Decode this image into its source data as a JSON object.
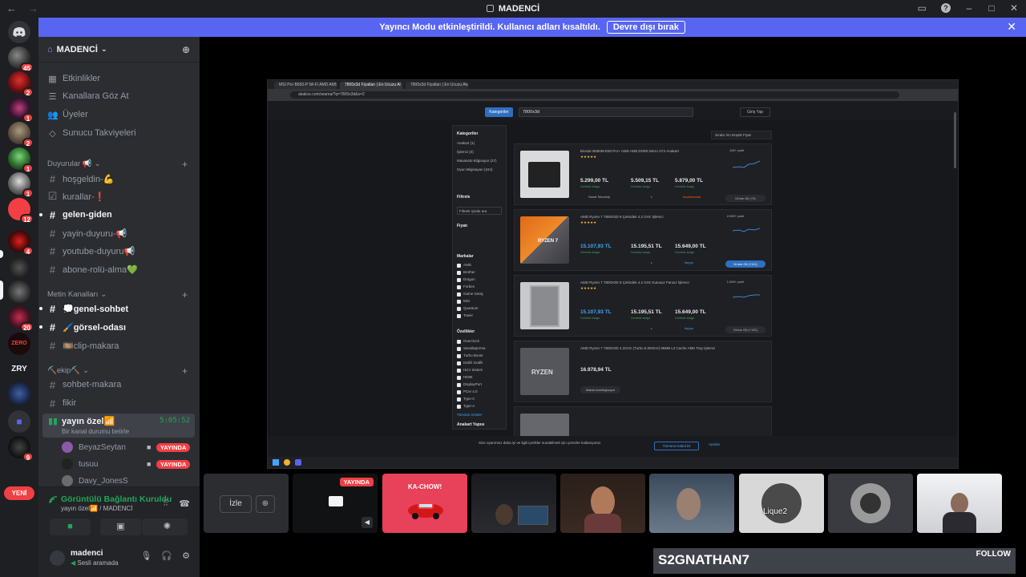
{
  "window": {
    "title": "MADENCİ"
  },
  "banner": {
    "text": "Yayıncı Modu etkinleştirildi. Kullanıcı adları kısaltıldı.",
    "button": "Devre dışı bırak"
  },
  "guilds": {
    "badges": [
      "45",
      "2",
      "1",
      "2",
      "1",
      "1",
      "12",
      "4",
      "20",
      "9"
    ],
    "zry": "ZRY",
    "new_label": "YENİ"
  },
  "server": {
    "name": "MADENCİ",
    "nav": [
      {
        "icon": "calendar-icon",
        "label": "Etkinlikler"
      },
      {
        "icon": "browse-icon",
        "label": "Kanallara Göz At"
      },
      {
        "icon": "members-icon",
        "label": "Üyeler"
      },
      {
        "icon": "boost-icon",
        "label": "Sunucu Takviyeleri"
      }
    ],
    "categories": {
      "duyurular": "Duyurular 📢",
      "metin": "Metin Kanalları",
      "ekip": "⛏️ekip⛏️"
    },
    "channels_duyurular": [
      {
        "name": "hoşgeldin-💪",
        "unread": false
      },
      {
        "name": "kurallar-❗",
        "unread": false
      },
      {
        "name": "gelen-giden",
        "unread": true
      },
      {
        "name": "yayin-duyuru-📢",
        "unread": false
      },
      {
        "name": "youtube-duyuru📢",
        "unread": false
      },
      {
        "name": "abone-rolü-alma💚",
        "unread": false
      }
    ],
    "channels_metin": [
      {
        "name": "💭genel-sohbet",
        "unread": true
      },
      {
        "name": "🖌️görsel-odası",
        "unread": true
      },
      {
        "name": "🎞️clip-makara",
        "unread": false
      }
    ],
    "channels_ekip": [
      {
        "name": "sohbet-makara",
        "unread": false
      },
      {
        "name": "fikir",
        "unread": false
      }
    ],
    "voice": {
      "name": "yayın özel📶",
      "time": "5:05:52",
      "status": "Bir kanal durumu belirle",
      "members": [
        {
          "name": "BeyazSeytan",
          "live": "YAYINDA"
        },
        {
          "name": "tusuu",
          "live": "YAYINDA"
        },
        {
          "name": "Davy_JonesS",
          "live": ""
        }
      ]
    }
  },
  "rtc": {
    "state": "Görüntülü Bağlantı Kuruldu",
    "sub": "yayın özel📶 / MADENCİ"
  },
  "user": {
    "name": "madenci",
    "status": "Sesli aramada"
  },
  "stream": {
    "tabs": [
      "MSI Pro B650-P Wi-Fi AMD AM5",
      "7800x3d Fiyatları | En Ucuzu Al",
      "7800x3d Fiyatları | En Ucuzu Akak"
    ],
    "url": "akakce.com/arama/?q=7800x3d&s=2",
    "category_btn": "Kategoriler",
    "search": "7800x3d",
    "login": "Giriş Yap",
    "sort": "Sırala: En Düşük Fiyat",
    "filter_sections": {
      "kategoriler": "Kategoriler",
      "kat_items": [
        "Anakart (1)",
        "İşlemci (3)",
        "Masaüstü Bilgisayar (27)",
        "Oyun Bilgisayarı (344)"
      ],
      "filtrele": "Filtrele",
      "filter_ph": "Filtrele içinde ara",
      "fiyat": "Fiyatı",
      "markalar": "Markalar",
      "brands": [
        "AMD",
        "Brother",
        "Dragon",
        "Forbes",
        "Game Garaj",
        "MSI",
        "Quantum",
        "Tower"
      ],
      "ozellikler": "Özellikler",
      "features": [
        "Overclock",
        "Sanallaştırma",
        "Turbo Boost",
        "Dahili Grafik",
        "Hizır Sistem",
        "HDMI",
        "DisplayPort",
        "PCIe 4.0",
        "Type-C",
        "Type-A"
      ],
      "more": "Tümünü Göster",
      "anakart": "Anakart Yapısı"
    },
    "products": [
      {
        "name": "Biostar B650M-E50 Pro+ AMD AM5 DDR5 Micro ATX Anakart",
        "count": "100+ parti",
        "prices": [
          "5.299,00 TL",
          "5.509,15 TL",
          "5.879,00 TL"
        ],
        "cargo": [
          "Ücretsiz kargo",
          "Ücretsiz kargo",
          "Ücretsiz kargo"
        ],
        "sellers": [
          "Sanal Teknoloji",
          "▸",
          "hepsiburada"
        ],
        "go": "Ürüne Git (+3)"
      },
      {
        "name": "AMD Ryzen 7 7800X3D 8 Çekirdek 4.2 GHz İşlemci",
        "count": "2.000+ parti",
        "prices": [
          "15.107,93 TL",
          "15.195,51 TL",
          "15.649,00 TL"
        ],
        "cargo": [
          "Ücretsiz kargo",
          "Ücretsiz kargo",
          "Ücretsiz kargo"
        ],
        "sellers": [
          "",
          "▸",
          "itopya"
        ],
        "go": "Ürüne Git (+111)"
      },
      {
        "name": "AMD Ryzen 7 7800X3D 8 Çekirdek 4.2 GHz Kutusuz Fansız İşlemci",
        "count": "1.000+ parti",
        "prices": [
          "15.107,93 TL",
          "15.195,51 TL",
          "15.649,00 TL"
        ],
        "cargo": [
          "Ücretsiz kargo",
          "Ücretsiz kargo",
          "Ücretsiz kargo"
        ],
        "sellers": [
          "",
          "▸",
          "itopya"
        ],
        "go": "Ürüne Git (+132)"
      },
      {
        "name": "AMD Ryzen 7 7800X3D 4.2GHz (Turbo 5.05GHz) 96MB L3 Cache AM5 Tray İşlemci",
        "count": "",
        "prices": [
          "16.978,94 TL",
          "",
          ""
        ],
        "cargo": [
          "",
          "",
          ""
        ],
        "sellers": [
          "Maksimumbilgisayar",
          "",
          ""
        ],
        "go": ""
      }
    ],
    "cookie_text": "Size uyarımsız daha iyi ve ilgili içerikler sunabilmek için çerezler kullanıyoruz.",
    "cookie_accept": "Tümünü Kabul Et",
    "cookie_settings": "Ayarlar"
  },
  "tiles": {
    "watch": "İzle",
    "live": "YAYINDA",
    "kachow": "KA-CHOW!",
    "tag": "Lique2"
  },
  "follow": {
    "name": "S2GNATHAN7",
    "label": "FOLLOW"
  }
}
